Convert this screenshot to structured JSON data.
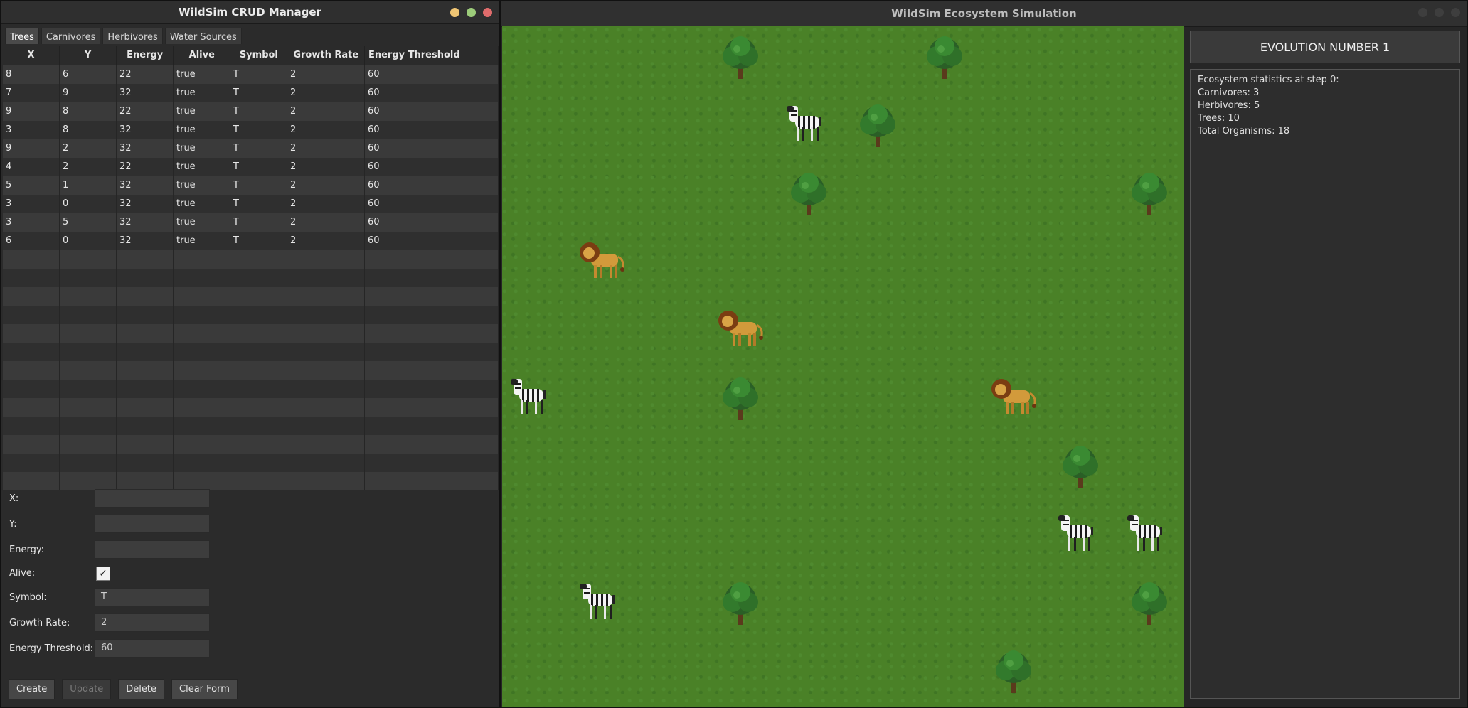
{
  "crud": {
    "title": "WildSim CRUD Manager",
    "tabs": [
      "Trees",
      "Carnivores",
      "Herbivores",
      "Water Sources"
    ],
    "columns": [
      "X",
      "Y",
      "Energy",
      "Alive",
      "Symbol",
      "Growth Rate",
      "Energy Threshold",
      ""
    ],
    "rows": [
      [
        "8",
        "6",
        "22",
        "true",
        "T",
        "2",
        "60"
      ],
      [
        "7",
        "9",
        "32",
        "true",
        "T",
        "2",
        "60"
      ],
      [
        "9",
        "8",
        "22",
        "true",
        "T",
        "2",
        "60"
      ],
      [
        "3",
        "8",
        "32",
        "true",
        "T",
        "2",
        "60"
      ],
      [
        "9",
        "2",
        "32",
        "true",
        "T",
        "2",
        "60"
      ],
      [
        "4",
        "2",
        "22",
        "true",
        "T",
        "2",
        "60"
      ],
      [
        "5",
        "1",
        "32",
        "true",
        "T",
        "2",
        "60"
      ],
      [
        "3",
        "0",
        "32",
        "true",
        "T",
        "2",
        "60"
      ],
      [
        "3",
        "5",
        "32",
        "true",
        "T",
        "2",
        "60"
      ],
      [
        "6",
        "0",
        "32",
        "true",
        "T",
        "2",
        "60"
      ]
    ],
    "form": {
      "x_label": "X:",
      "x_value": "",
      "y_label": "Y:",
      "y_value": "",
      "energy_label": "Energy:",
      "energy_value": "",
      "alive_label": "Alive:",
      "alive_checked": true,
      "symbol_label": "Symbol:",
      "symbol_value": "T",
      "growth_label": "Growth Rate:",
      "growth_value": "2",
      "threshold_label": "Energy Threshold:",
      "threshold_value": "60"
    },
    "buttons": {
      "create": "Create",
      "update": "Update",
      "delete": "Delete",
      "clear": "Clear Form"
    }
  },
  "sim": {
    "title": "WildSim Ecosystem Simulation",
    "evolution_label": "EVOLUTION NUMBER 1",
    "stats": [
      "Ecosystem statistics at step 0:",
      "Carnivores: 3",
      "Herbivores: 5",
      "Trees: 10",
      "Total Organisms: 18"
    ]
  },
  "colors": {
    "grass": "#4a8127",
    "tree": "#2f6b2a",
    "zebra": "#ffffff",
    "lion": "#c98a2e"
  }
}
